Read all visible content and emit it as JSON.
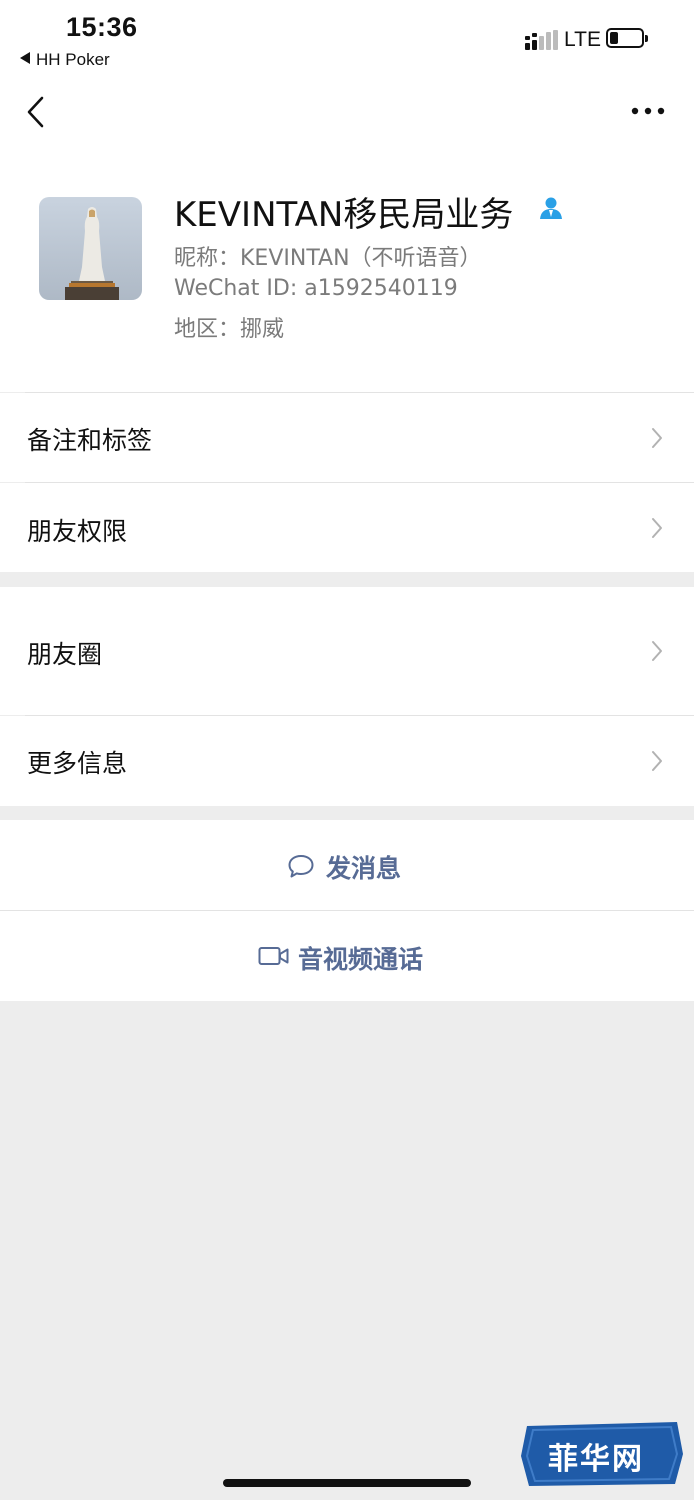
{
  "status_bar": {
    "time": "15:36",
    "back_app": "HH Poker",
    "network": "LTE",
    "icons": [
      "signal-icon",
      "battery-icon"
    ]
  },
  "nav": {
    "icons": [
      "back-chevron-icon",
      "more-dots-icon"
    ]
  },
  "profile": {
    "name": "KEVINTAN移民局业务",
    "nickname": "昵称：KEVINTAN（不听语音）",
    "wechat_id": "WeChat ID: a1592540119",
    "region": "地区：挪威",
    "verified_icon": "person-verified-icon",
    "avatar": "statue-photo"
  },
  "menu": {
    "group1": [
      {
        "label": "备注和标签"
      },
      {
        "label": "朋友权限"
      }
    ],
    "group2": [
      {
        "label": "朋友圈"
      },
      {
        "label": "更多信息"
      }
    ]
  },
  "actions": {
    "message": {
      "label": "发消息",
      "icon": "chat-bubble-icon"
    },
    "call": {
      "label": "音视频通话",
      "icon": "video-camera-icon"
    }
  },
  "watermark": {
    "text": "菲华网"
  },
  "colors": {
    "accent": "#576b95",
    "background": "#ededed",
    "secondary_text": "#7b7b7b"
  }
}
